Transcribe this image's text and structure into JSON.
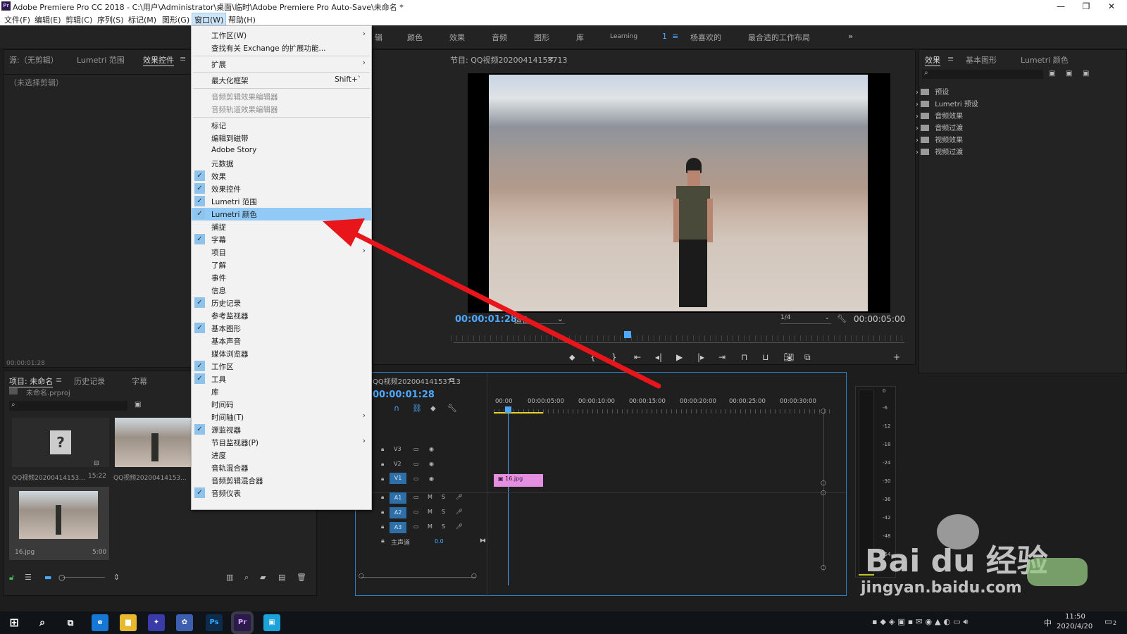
{
  "window": {
    "title": "Adobe Premiere Pro CC 2018 - C:\\用户\\Administrator\\桌面\\临时\\Adobe Premiere Pro Auto-Save\\未命名 *",
    "app_badge": "Pr"
  },
  "menubar": {
    "items": [
      "文件(F)",
      "编辑(E)",
      "剪辑(C)",
      "序列(S)",
      "标记(M)",
      "图形(G)",
      "窗口(W)",
      "帮助(H)"
    ]
  },
  "workspaces": [
    "辑",
    "颜色",
    "效果",
    "音频",
    "图形",
    "库",
    "Learning",
    "1",
    "杨喜欢的",
    "最合适的工作布局"
  ],
  "source_panel": {
    "tabs": [
      "源:（无剪辑）",
      "Lumetri 范围",
      "效果控件"
    ],
    "content": "（未选择剪辑）",
    "timecode": "00:00:01:28"
  },
  "program_monitor": {
    "title": "节目: QQ视频20200414153713",
    "timecode": "00:00:01:28",
    "fit": "适合",
    "quality": "1/4",
    "duration": "00:00:05:00"
  },
  "effects_panel": {
    "tabs": [
      "效果",
      "基本图形",
      "Lumetri 颜色"
    ],
    "items": [
      "预设",
      "Lumetri 预设",
      "音频效果",
      "音频过渡",
      "视频效果",
      "视频过渡"
    ]
  },
  "project_panel": {
    "tabs": [
      "项目: 未命名",
      "历史记录",
      "字幕"
    ],
    "file": "未命名.prproj",
    "items": [
      {
        "name": "QQ视频20200414153...",
        "dur": "15:22"
      },
      {
        "name": "QQ视频20200414153..."
      },
      {
        "name": "16.jpg",
        "dur": "5:00"
      }
    ]
  },
  "timeline": {
    "title": "QQ视频20200414153713",
    "timecode": "00:00:01:28",
    "ruler": [
      "00:00",
      "00:00:05:00",
      "00:00:10:00",
      "00:00:15:00",
      "00:00:20:00",
      "00:00:25:00",
      "00:00:30:00"
    ],
    "video_tracks": [
      "V3",
      "V2",
      "V1"
    ],
    "audio_tracks": [
      "A1",
      "A2",
      "A3"
    ],
    "master": "主声道",
    "master_val": "0.0",
    "clip": "16.jpg"
  },
  "meter_scale": [
    "0",
    "-6",
    "-12",
    "-18",
    "-24",
    "-30",
    "-36",
    "-42",
    "-48",
    "-54"
  ],
  "window_menu": [
    {
      "label": "工作区(W)",
      "arrow": true
    },
    {
      "label": "查找有关 Exchange 的扩展功能..."
    },
    {
      "sep": true
    },
    {
      "label": "扩展",
      "arrow": true
    },
    {
      "sep": true
    },
    {
      "label": "最大化框架",
      "shortcut": "Shift+`"
    },
    {
      "sep": true
    },
    {
      "label": "音频剪辑效果编辑器",
      "disabled": true
    },
    {
      "label": "音频轨道效果编辑器",
      "disabled": true
    },
    {
      "sep": true
    },
    {
      "label": "标记"
    },
    {
      "label": "编辑到磁带"
    },
    {
      "label": "Adobe Story"
    },
    {
      "label": "元数据"
    },
    {
      "label": "效果",
      "checked": true
    },
    {
      "label": "效果控件",
      "checked": true
    },
    {
      "label": "Lumetri 范围",
      "checked": true
    },
    {
      "label": "Lumetri 颜色",
      "checked": true,
      "highlight": true
    },
    {
      "label": "捕捉"
    },
    {
      "label": "字幕",
      "checked": true
    },
    {
      "label": "项目",
      "arrow": true
    },
    {
      "label": "了解"
    },
    {
      "label": "事件"
    },
    {
      "label": "信息"
    },
    {
      "label": "历史记录",
      "checked": true
    },
    {
      "label": "参考监视器"
    },
    {
      "label": "基本图形",
      "checked": true
    },
    {
      "label": "基本声音"
    },
    {
      "label": "媒体浏览器"
    },
    {
      "label": "工作区",
      "checked": true
    },
    {
      "label": "工具",
      "checked": true
    },
    {
      "label": "库"
    },
    {
      "label": "时间码"
    },
    {
      "label": "时间轴(T)",
      "arrow": true
    },
    {
      "label": "源监视器",
      "checked": true
    },
    {
      "label": "节目监视器(P)",
      "arrow": true
    },
    {
      "label": "进度"
    },
    {
      "label": "音轨混合器"
    },
    {
      "label": "音频剪辑混合器"
    },
    {
      "label": "音频仪表",
      "checked": true
    }
  ],
  "taskbar": {
    "time": "11:50",
    "date": "2020/4/20",
    "ime": "中",
    "notif": "2"
  },
  "watermark": {
    "brand": "Bai du 经验",
    "url": "jingyan.baidu.com"
  }
}
